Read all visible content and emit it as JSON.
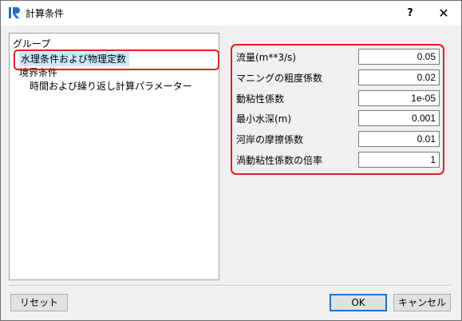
{
  "window": {
    "title": "計算条件",
    "help_label": "?",
    "close_label": "✕"
  },
  "groups": {
    "header": "グループ",
    "items": [
      {
        "label": "水理条件および物理定数"
      },
      {
        "label": "境界条件"
      },
      {
        "label": "時間および繰り返し計算パラメーター"
      }
    ]
  },
  "params": [
    {
      "label": "流量(m**3/s)",
      "value": "0.05"
    },
    {
      "label": "マニングの粗度係数",
      "value": "0.02"
    },
    {
      "label": "動粘性係数",
      "value": "1e-05"
    },
    {
      "label": "最小水深(m)",
      "value": "0.001"
    },
    {
      "label": "河岸の摩擦係数",
      "value": "0.01"
    },
    {
      "label": "渦動粘性係数の倍率",
      "value": "1"
    }
  ],
  "buttons": {
    "reset": "リセット",
    "ok": "OK",
    "cancel": "キャンセル"
  },
  "colors": {
    "highlight": "#e02020",
    "selection": "#cce8ff",
    "app_icon": "#2a6db5"
  }
}
